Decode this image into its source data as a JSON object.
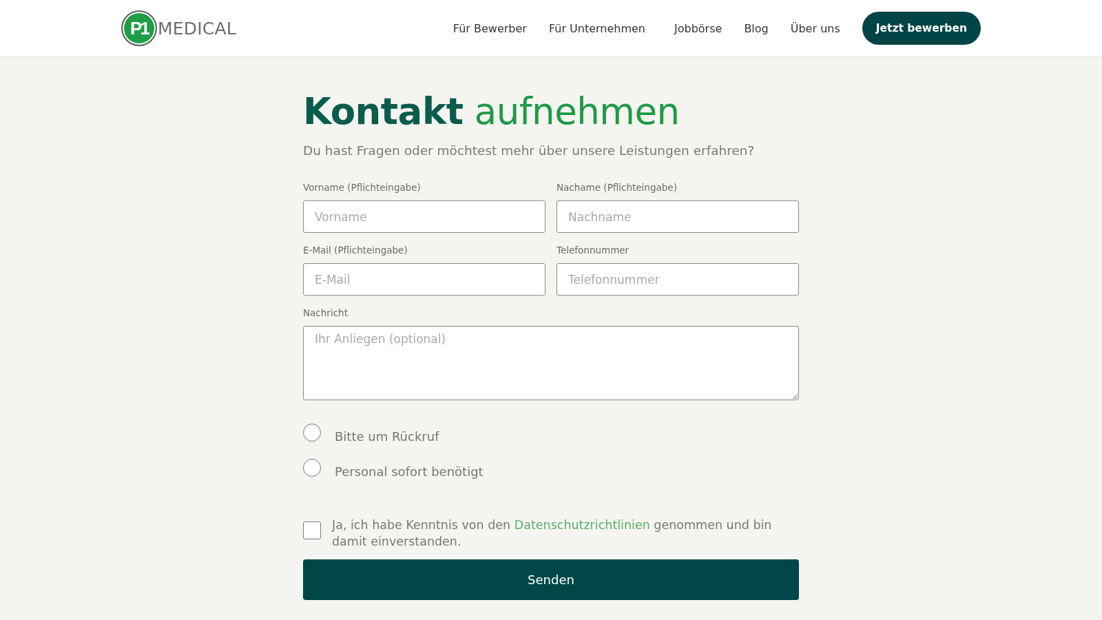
{
  "header": {
    "logo": {
      "mark": "P1",
      "wordmark": "MEDICAL"
    },
    "nav": [
      {
        "label": "Für Bewerber"
      },
      {
        "label": "Für Unternehmen"
      },
      {
        "label": "Jobbörse"
      },
      {
        "label": "Blog"
      },
      {
        "label": "Über uns"
      }
    ],
    "cta": "Jetzt bewerben"
  },
  "contact": {
    "title": "**Kontakt** aufnehmen",
    "subtitle": "Du hast Fragen oder möchtest mehr über unsere Leistungen erfahren?",
    "fields": [
      {
        "kind": "input",
        "label": "Vorname (Pflichteingabe)",
        "placeholder": "Vorname"
      },
      {
        "kind": "input",
        "label": "Nachame (Pflichteingabe)",
        "placeholder": "Nachname"
      },
      {
        "kind": "input",
        "label": "E-Mail (Pflichteingabe)",
        "placeholder": "E-Mail"
      },
      {
        "kind": "input",
        "label": "Telefonnummer",
        "placeholder": "Telefonnummer"
      },
      {
        "kind": "textarea",
        "label": "Nachricht",
        "placeholder": "Ihr Anliegen (optional)"
      }
    ],
    "options": [
      {
        "label": "Bitte um Rückruf",
        "selected": false
      },
      {
        "label": "Personal sofort benötigt",
        "selected": false
      }
    ],
    "consent": {
      "checked": false,
      "text_before": "Ja, ich habe Kenntnis von den",
      "link": "Datenschutzrichtlinien",
      "text_after": "genommen und bin damit einverstanden."
    },
    "submit": "Senden"
  }
}
